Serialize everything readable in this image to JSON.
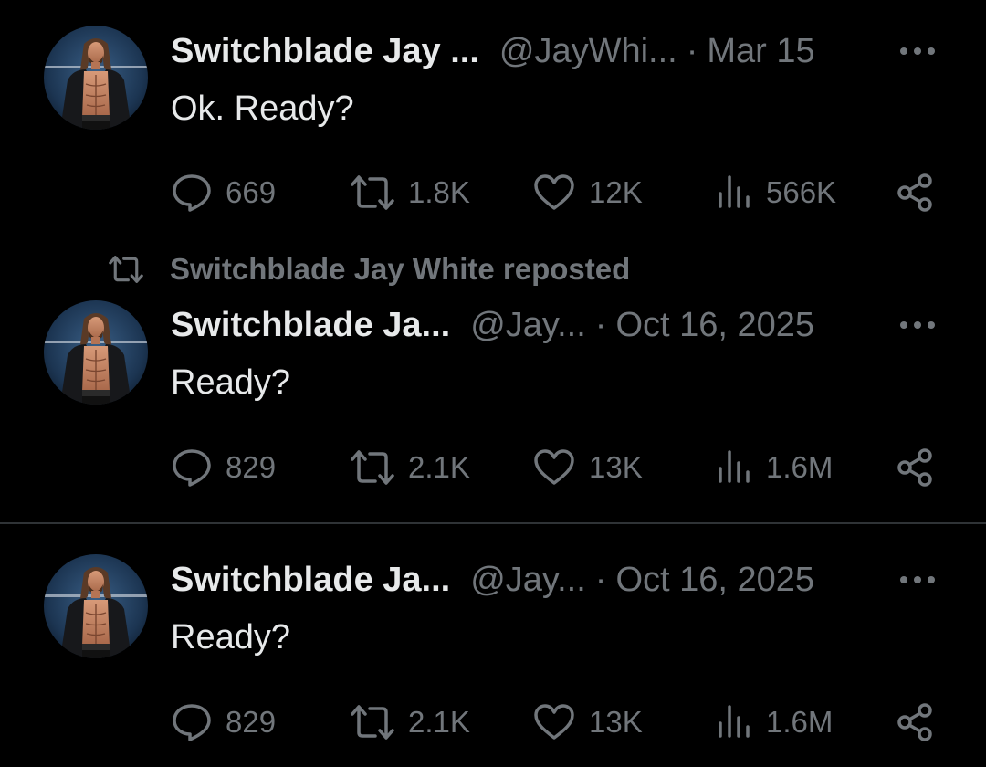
{
  "tweets": [
    {
      "author_name": "Switchblade Jay ...",
      "handle": "@JayWhi...",
      "separator": "·",
      "date": "Mar 15",
      "text": "Ok. Ready?",
      "replies": "669",
      "reposts": "1.8K",
      "likes": "12K",
      "views": "566K"
    },
    {
      "repost_banner": "Switchblade Jay White reposted",
      "author_name": "Switchblade Ja...",
      "handle": "@Jay...",
      "separator": "·",
      "date": "Oct 16, 2025",
      "text": "Ready?",
      "replies": "829",
      "reposts": "2.1K",
      "likes": "13K",
      "views": "1.6M"
    },
    {
      "author_name": "Switchblade Ja...",
      "handle": "@Jay...",
      "separator": "·",
      "date": "Oct 16, 2025",
      "text": "Ready?",
      "replies": "829",
      "reposts": "2.1K",
      "likes": "13K",
      "views": "1.6M"
    }
  ],
  "icons": {
    "reply": "speech-bubble-icon",
    "repost": "repost-arrows-icon",
    "like": "heart-icon",
    "views": "bar-chart-icon",
    "share": "share-icon",
    "more": "ellipsis-icon"
  },
  "colors": {
    "background": "#000000",
    "primary_text": "#e7e9ea",
    "secondary_text": "#71767b",
    "divider": "#2f3336"
  }
}
